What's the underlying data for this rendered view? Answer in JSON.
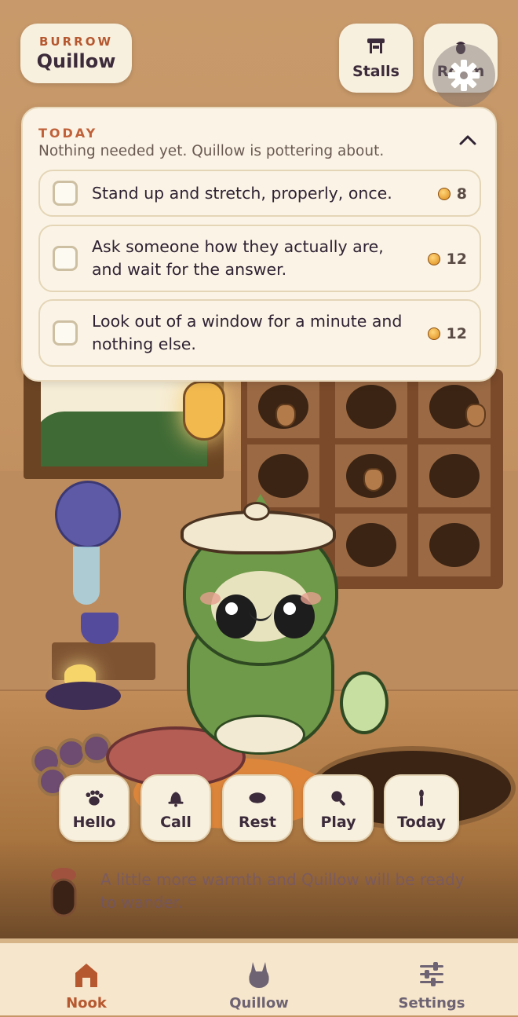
{
  "header": {
    "burrow_label": "BURROW",
    "burrow_name": "Quillow",
    "stalls_label": "Stalls",
    "room_label": "Room"
  },
  "today": {
    "label": "TODAY",
    "subtitle": "Nothing needed yet. Quillow is pottering about.",
    "tasks": [
      {
        "text": "Stand up and stretch, properly, once.",
        "reward": "8"
      },
      {
        "text": "Ask someone how they actually are, and wait for the answer.",
        "reward": "12"
      },
      {
        "text": "Look out of a window for a minute and nothing else.",
        "reward": "12"
      }
    ]
  },
  "actions": [
    {
      "label": "Hello",
      "icon": "paw-icon"
    },
    {
      "label": "Call",
      "icon": "bell-icon"
    },
    {
      "label": "Rest",
      "icon": "pillow-icon"
    },
    {
      "label": "Play",
      "icon": "magnifier-icon"
    },
    {
      "label": "Today",
      "icon": "torch-icon"
    }
  ],
  "status": {
    "message": "A little more warmth and Quillow will be ready to wander."
  },
  "tabs": [
    {
      "label": "Nook",
      "icon": "house-icon",
      "active": true
    },
    {
      "label": "Quillow",
      "icon": "bunny-icon",
      "active": false
    },
    {
      "label": "Settings",
      "icon": "sliders-icon",
      "active": false
    }
  ],
  "colors": {
    "accent": "#c0613a",
    "active_tab": "#b6582f",
    "inactive_tab": "#6d6373",
    "card_bg": "#fbf4e6"
  }
}
